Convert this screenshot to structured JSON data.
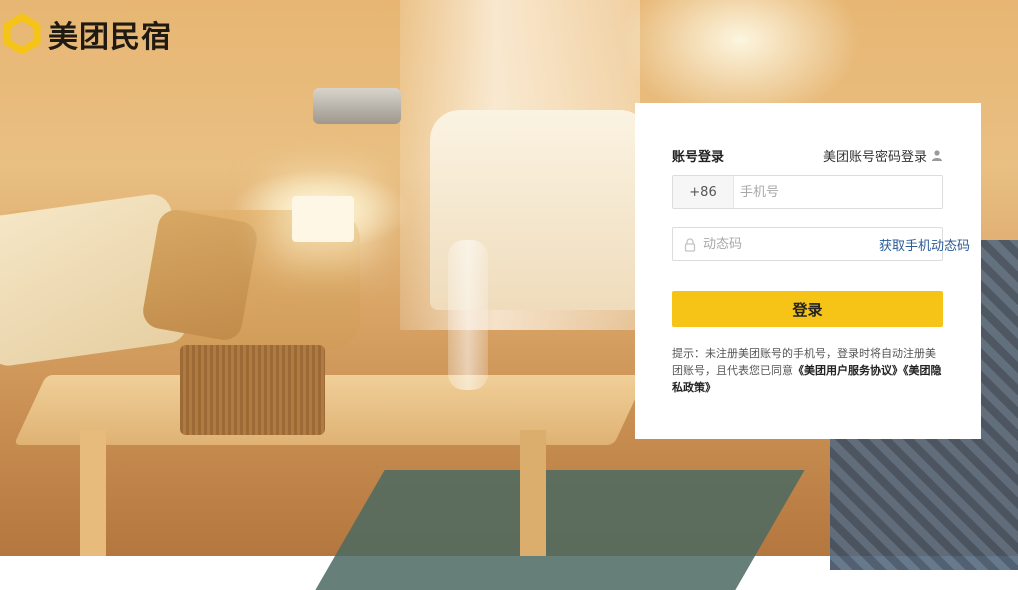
{
  "brand": {
    "name": "美团民宿",
    "logo_color": "#f5c417"
  },
  "login": {
    "title": "账号登录",
    "switch_link": "美团账号密码登录",
    "switch_icon": "user-icon",
    "country_code": "+86",
    "phone_placeholder": "手机号",
    "code_placeholder": "动态码",
    "code_icon": "lock-icon",
    "get_code_label": "获取手机动态码",
    "submit_label": "登录",
    "button_color": "#f5c417",
    "tip_text": "提示：未注册美团账号的手机号，登录时将自动注册美团账号，且代表您已同意",
    "agreement_user": "《美团用户服务协议》",
    "agreement_privacy": "《美团隐私政策》"
  }
}
